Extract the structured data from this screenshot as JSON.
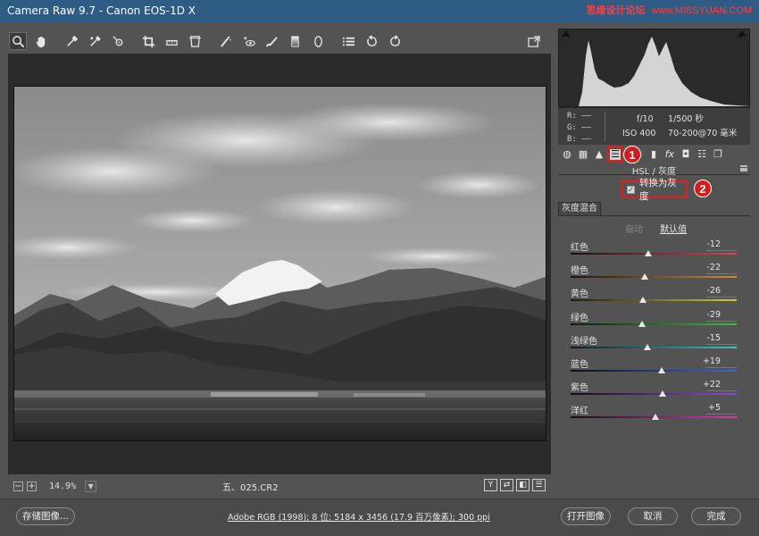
{
  "window": {
    "title": "Camera Raw 9.7 -  Canon EOS-1D X",
    "watermark_zh": "思缘设计论坛",
    "watermark_site": "www.MISSYUAN.COM"
  },
  "toolbar": {
    "tools": [
      "zoom-icon",
      "hand-icon",
      "white-balance-icon",
      "color-sampler-icon",
      "targeted-adjust-icon",
      "crop-icon",
      "straighten-icon",
      "transform-icon",
      "spot-removal-icon",
      "red-eye-icon",
      "adjustment-brush-icon",
      "graduated-filter-icon",
      "radial-filter-icon",
      "preferences-icon",
      "rotate-ccw-icon",
      "rotate-cw-icon"
    ],
    "open_export": "toggle-fullscreen-icon"
  },
  "canvas": {
    "zoom_minus": "−",
    "zoom_plus": "+",
    "zoom": "14.9%",
    "filename": "五、025.CR2",
    "view_buttons": [
      "Y",
      "⇄",
      "◧",
      "☰"
    ]
  },
  "histogram": {
    "r_label": "R:",
    "g_label": "G:",
    "b_label": "B:",
    "r_value": "——",
    "g_value": "——",
    "b_value": "——",
    "aperture": "f/10",
    "shutter": "1/500 秒",
    "iso": "ISO 400",
    "lens": "70-200@70 毫米"
  },
  "panel": {
    "tab_icons": [
      "basic-icon",
      "tone-curve-icon",
      "detail-icon",
      "hsl-icon",
      "split-tone-icon",
      "lens-icon",
      "fx-icon",
      "camera-calibration-icon",
      "presets-icon",
      "snapshots-icon"
    ],
    "badge1": "1",
    "badge2": "2",
    "title": "HSL / 灰度",
    "convert_gray": "转换为灰度",
    "subtab": "灰度混合",
    "mode_auto": "自动",
    "mode_default": "默认值"
  },
  "sliders": [
    {
      "label": "红色",
      "value": "-12",
      "num": -12,
      "color_a": "#1a0f0f",
      "color_b": "#d14a4a"
    },
    {
      "label": "橙色",
      "value": "-22",
      "num": -22,
      "color_a": "#1a140c",
      "color_b": "#d08a3c"
    },
    {
      "label": "黄色",
      "value": "-26",
      "num": -26,
      "color_a": "#1a1a0c",
      "color_b": "#d4c73a"
    },
    {
      "label": "绿色",
      "value": "-29",
      "num": -29,
      "color_a": "#0c1a0c",
      "color_b": "#3cbe3c"
    },
    {
      "label": "浅绿色",
      "value": "-15",
      "num": -15,
      "color_a": "#0c1a1a",
      "color_b": "#3cc4c4"
    },
    {
      "label": "蓝色",
      "value": "+19",
      "num": 19,
      "color_a": "#0c0c1a",
      "color_b": "#3c6ad4"
    },
    {
      "label": "紫色",
      "value": "+22",
      "num": 22,
      "color_a": "#140c1a",
      "color_b": "#8a4ad4"
    },
    {
      "label": "洋红",
      "value": "+5",
      "num": 5,
      "color_a": "#1a0c14",
      "color_b": "#d43cb4"
    }
  ],
  "footer": {
    "save": "存储图像...",
    "workflow": "Adobe RGB (1998); 8 位; 5184 x 3456 (17.9 百万像素); 300 ppi",
    "open": "打开图像",
    "cancel": "取消",
    "done": "完成"
  },
  "colors": {
    "accent_highlight": "#e11d1d",
    "titlebar": "#2f5c84"
  }
}
